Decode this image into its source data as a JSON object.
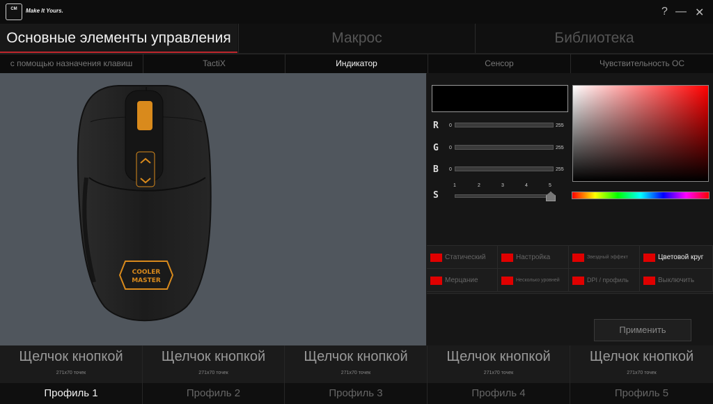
{
  "app": {
    "logo_text": "COOLER MASTER",
    "tagline": "Make It Yours.",
    "window_controls": {
      "help": "?",
      "minimize": "—",
      "close": "✕"
    }
  },
  "main_tabs": [
    {
      "label": "Основные элементы управления",
      "active": true
    },
    {
      "label": "Макрос",
      "active": false
    },
    {
      "label": "Библиотека",
      "active": false
    }
  ],
  "sub_tabs": [
    {
      "label": "с помощью назначения клавиш",
      "active": false
    },
    {
      "label": "TactiX",
      "active": false
    },
    {
      "label": "Индикатор",
      "active": true
    },
    {
      "label": "Сенсор",
      "active": false
    },
    {
      "label": "Чувствительность ОС",
      "active": false
    }
  ],
  "lighting": {
    "current_color": "#000000",
    "sliders": [
      {
        "label": "R",
        "min": "0",
        "max": "255"
      },
      {
        "label": "G",
        "min": "0",
        "max": "255"
      },
      {
        "label": "B",
        "min": "0",
        "max": "255"
      }
    ],
    "speed": {
      "label": "S",
      "ticks": [
        "1",
        "2",
        "3",
        "4",
        "5"
      ],
      "value": 5
    },
    "effects_row1": [
      {
        "label": "Статический",
        "active": false
      },
      {
        "label": "Настройка",
        "active": false
      },
      {
        "label": "Звездный эффект",
        "active": false
      },
      {
        "label": "Цветовой круг",
        "active": true
      }
    ],
    "effects_row2": [
      {
        "label": "Мерцание",
        "active": false
      },
      {
        "label": "Несколько уровней",
        "active": false
      },
      {
        "label": "DPI / профиль",
        "active": false
      },
      {
        "label": "Выключить",
        "active": false
      }
    ],
    "apply_label": "Применить"
  },
  "profiles": [
    {
      "button_label": "Щелчок кнопкой",
      "size_note": "271x70 точек",
      "name": "Профиль 1",
      "active": true
    },
    {
      "button_label": "Щелчок кнопкой",
      "size_note": "271x70 точек",
      "name": "Профиль 2",
      "active": false
    },
    {
      "button_label": "Щелчок кнопкой",
      "size_note": "271x70 точек",
      "name": "Профиль 3",
      "active": false
    },
    {
      "button_label": "Щелчок кнопкой",
      "size_note": "271x70 точек",
      "name": "Профиль 4",
      "active": false
    },
    {
      "button_label": "Щелчок кнопкой",
      "size_note": "271x70 точек",
      "name": "Профиль 5",
      "active": false
    }
  ],
  "colors": {
    "accent": "#c0272d",
    "effect_swatch": "#e00000",
    "mouse_highlight": "#d98a1c"
  }
}
